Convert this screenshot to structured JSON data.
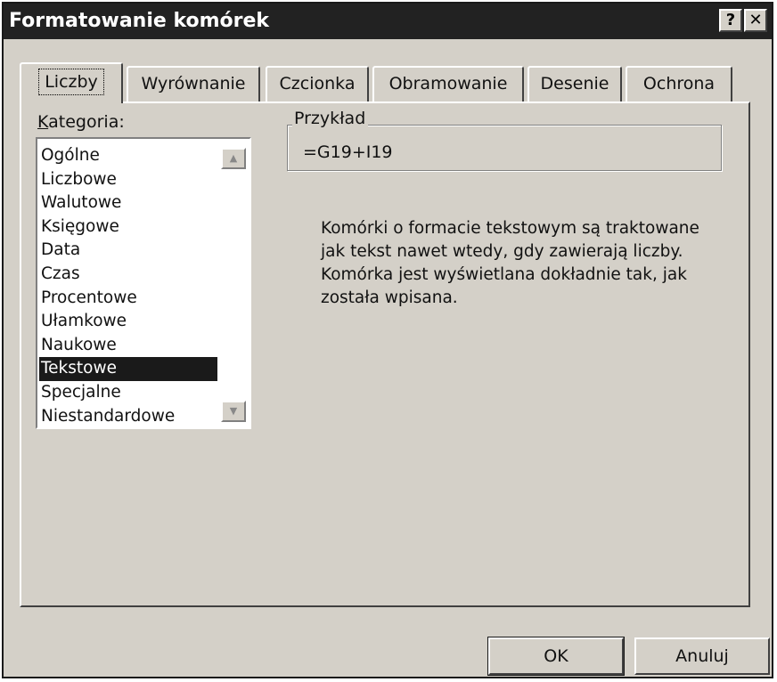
{
  "window": {
    "title": "Formatowanie komórek",
    "help_glyph": "?",
    "close_glyph": "✕"
  },
  "tabs": [
    {
      "label": "Liczby",
      "active": true
    },
    {
      "label": "Wyrównanie",
      "active": false
    },
    {
      "label": "Czcionka",
      "active": false
    },
    {
      "label": "Obramowanie",
      "active": false
    },
    {
      "label": "Desenie",
      "active": false
    },
    {
      "label": "Ochrona",
      "active": false
    }
  ],
  "category": {
    "label_first": "K",
    "label_rest": "ategoria:",
    "items": [
      "Ogólne",
      "Liczbowe",
      "Walutowe",
      "Księgowe",
      "Data",
      "Czas",
      "Procentowe",
      "Ułamkowe",
      "Naukowe",
      "Tekstowe",
      "Specjalne",
      "Niestandardowe"
    ],
    "selected": "Tekstowe"
  },
  "sample": {
    "legend": "Przykład",
    "value": "=G19+I19"
  },
  "description": {
    "lines": [
      "Komórki o formacie tekstowym są traktowane",
      "jak tekst nawet wtedy, gdy zawierają liczby.",
      "Komórka jest wyświetlana dokładnie tak, jak",
      "została wpisana."
    ]
  },
  "buttons": {
    "ok": "OK",
    "cancel": "Anuluj"
  },
  "icons": {
    "scroll_up": "scroll-up-arrow-icon",
    "scroll_down": "scroll-down-arrow-icon",
    "help": "help-icon",
    "close": "close-icon"
  }
}
